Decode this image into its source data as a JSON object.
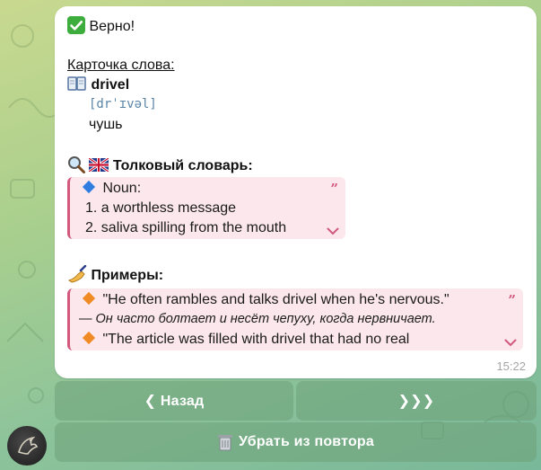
{
  "message": {
    "status_icon": "check-mark-icon",
    "status": "Верно!",
    "card_title": "Карточка слова:",
    "book_icon": "book-icon",
    "word": "drivel",
    "transcription": "[drˈɪvəl]",
    "translation": "чушь",
    "dictionary": {
      "icons": [
        "magnifier-icon",
        "uk-flag-icon"
      ],
      "title": "Толковый словарь:",
      "pos": "Noun:",
      "items": [
        "1. a worthless message",
        "2. saliva spilling from the mouth"
      ]
    },
    "examples": {
      "icon": "writing-hand-icon",
      "title": "Примеры:",
      "items": [
        "\"He often rambles and talks drivel when he's nervous.\"",
        "— Он часто болтает и несёт чепуху, когда нервничает.",
        "\"The article was filled with drivel that had no real"
      ]
    },
    "time": "15:22"
  },
  "keyboard": {
    "back_label": "❮ Назад",
    "forward_label": "❯❯❯",
    "remove_label": "Убрать из повтора",
    "remove_icon": "trash-icon"
  },
  "colors": {
    "quote_bg": "#fbe7ec",
    "quote_accent": "#d2587d",
    "transcription": "#5a84a6",
    "button_bg": "#6ea078"
  }
}
